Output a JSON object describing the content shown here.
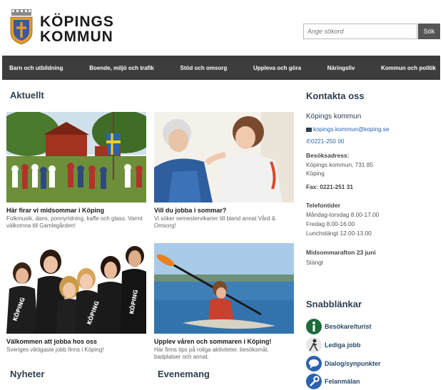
{
  "header": {
    "logo_line1": "KÖPINGS",
    "logo_line2": "KOMMUN",
    "search_placeholder": "Ange sökord",
    "search_button": "Sök"
  },
  "nav": {
    "items": [
      "Barn och utbildning",
      "Boende, miljö och trafik",
      "Stöd och omsorg",
      "Uppleva och göra",
      "Näringsliv",
      "Kommun och politik"
    ]
  },
  "aktuellt": {
    "heading": "Aktuellt",
    "cards": [
      {
        "title": "Här firar vi midsommar i Köping",
        "text": "Folkmusik, dans, ponnyridning, kaffe och glass. Varmt välkomna till Gamlegården!"
      },
      {
        "title": "Vill du jobba i sommar?",
        "text": "Vi söker semestervikarier till bland annat Vård & Omsorg!"
      },
      {
        "title": "Välkommen att jobba hos oss",
        "text": "Sveriges viktigaste jobb finns i Köping!"
      },
      {
        "title": "Upplev våren och sommaren i Köping!",
        "text": "Här finns tips på roliga aktiviteter, besöksmål, badplatser och annat."
      }
    ]
  },
  "bottom": {
    "nyheter": "Nyheter",
    "evenemang": "Evenemang"
  },
  "kontakt": {
    "heading": "Kontakta oss",
    "name": "Köpings kommun",
    "email": "kopings.kommun@koping.se",
    "phone": "0221-250 00",
    "address_label": "Besöksadress:",
    "address_line1": "Köpings kommun, 731 85",
    "address_line2": "Köping",
    "fax": "Fax: 0221-251 31",
    "hours_label": "Telefontider",
    "hours1": "Måndag-torsdag  8.00-17.00",
    "hours2": "Fredag   8.00-16.00",
    "hours3": "Lunchstängt  12.00-13.00",
    "note_label": "Midsommarafton 23 juni",
    "note_text": "Stängt"
  },
  "snabb": {
    "heading": "Snabblänkar",
    "links": [
      {
        "label": "Besökare/turist",
        "icon": "info-icon",
        "color": "#1e6b3a"
      },
      {
        "label": "Lediga jobb",
        "icon": "person-icon",
        "color": "#e8e8e8"
      },
      {
        "label": "Dialog/synpunkter",
        "icon": "speech-bubble-icon",
        "color": "#2a62b0"
      },
      {
        "label": "Felanmälan",
        "icon": "wrench-icon",
        "color": "#2a62b0"
      }
    ]
  },
  "colors": {
    "nav_bg": "#3d3d3d",
    "heading": "#2c3e50",
    "link": "#2a62b0"
  }
}
